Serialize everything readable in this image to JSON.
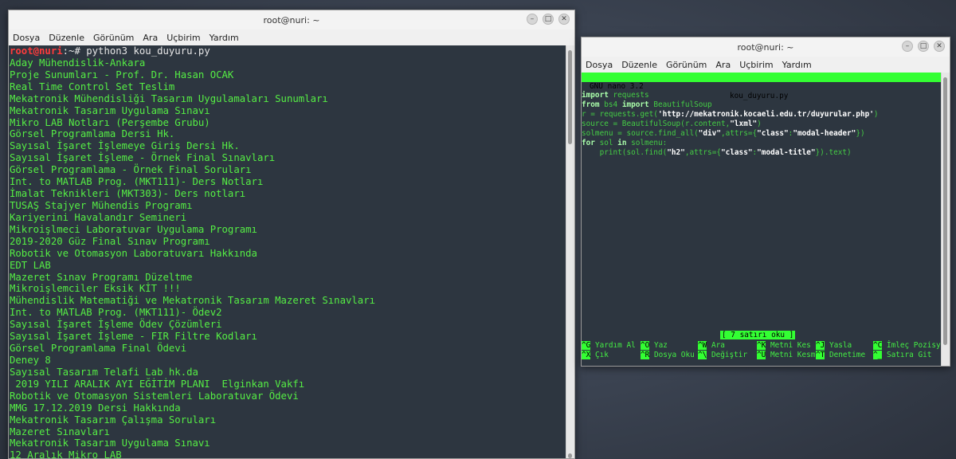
{
  "left_window": {
    "title": "root@nuri: ~",
    "menu": [
      "Dosya",
      "Düzenle",
      "Görünüm",
      "Ara",
      "Uçbirim",
      "Yardım"
    ],
    "prompt_user": "root@nuri",
    "prompt_rest": ":~# python3 kou_duyuru.py",
    "output_lines": [
      "Aday Mühendislik-Ankara",
      "Proje Sunumları - Prof. Dr. Hasan OCAK",
      "Real Time Control Set Teslim",
      "Mekatronik Mühendisliği Tasarım Uygulamaları Sunumları",
      "Mekatronik Tasarım Uygulama Sınavı",
      "Mikro LAB Notları (Perşembe Grubu)",
      "Görsel Programlama Dersi Hk.",
      "Sayısal İşaret İşlemeye Giriş Dersi Hk.",
      "Sayısal İşaret İşleme - Örnek Final Sınavları",
      "Görsel Programlama - Örnek Final Soruları",
      "Int. to MATLAB Prog. (MKT111)- Ders Notları",
      "İmalat Teknikleri (MKT303)- Ders notları",
      "TUSAŞ Stajyer Mühendis Programı",
      "Kariyerini Havalandır Semineri",
      "Mikroişlmeci Laboratuvar Uygulama Programı",
      "2019-2020 Güz Final Sınav Programı",
      "Robotik ve Otomasyon Laboratuvarı Hakkında",
      "EDT LAB",
      "Mazeret Sınav Programı Düzeltme",
      "Mikroişlemciler Eksik KİT !!!",
      "Mühendislik Matematiği ve Mekatronik Tasarım Mazeret Sınavları",
      "Int. to MATLAB Prog. (MKT111)- Ödev2",
      "Sayısal İşaret İşleme Ödev Çözümleri",
      "Sayısal İşaret İşleme - FIR Filtre Kodları",
      "Görsel Programlama Final Ödevi",
      "Deney 8",
      "Sayısal Tasarım Telafi Lab hk.da",
      " 2019 YILI ARALIK AYI EĞİTİM PLANI  Elginkan Vakfı",
      "Robotik ve Otomasyon Sistemleri Laboratuvar Ödevi",
      "MMG 17.12.2019 Dersi Hakkında",
      "Mekatronik Tasarım Çalışma Soruları",
      "Mazeret Sınavları",
      "Mekatronik Tasarım Uygulama Sınavı",
      "12 Aralık Mikro LAB"
    ]
  },
  "right_window": {
    "title": "root@nuri: ~",
    "menu": [
      "Dosya",
      "Düzenle",
      "Görünüm",
      "Ara",
      "Uçbirim",
      "Yardım"
    ],
    "nano_version": "GNU nano 3.2",
    "file_name": "kou_duyuru.py",
    "status_message": "[ 7 satırı oku ]",
    "code_lines": [
      [
        {
          "t": "import",
          "c": "kw"
        },
        {
          "t": " requests",
          "c": ""
        }
      ],
      [
        {
          "t": "from",
          "c": "kw"
        },
        {
          "t": " bs4 ",
          "c": ""
        },
        {
          "t": "import",
          "c": "kw"
        },
        {
          "t": " BeautifulSoup",
          "c": ""
        }
      ],
      [
        {
          "t": "r = requests.get(",
          "c": ""
        },
        {
          "t": "'http://mekatronik.kocaeli.edu.tr/duyurular.php'",
          "c": "str"
        },
        {
          "t": ")",
          "c": ""
        }
      ],
      [
        {
          "t": "source = BeautifulSoup(r.content,",
          "c": ""
        },
        {
          "t": "\"lxml\"",
          "c": "str"
        },
        {
          "t": ")",
          "c": ""
        }
      ],
      [
        {
          "t": "solmenu = source.find_all(",
          "c": ""
        },
        {
          "t": "\"div\"",
          "c": "str"
        },
        {
          "t": ",attrs={",
          "c": ""
        },
        {
          "t": "\"class\"",
          "c": "str"
        },
        {
          "t": ":",
          "c": ""
        },
        {
          "t": "\"modal-header\"",
          "c": "str"
        },
        {
          "t": "})",
          "c": ""
        }
      ],
      [
        {
          "t": "for",
          "c": "kw"
        },
        {
          "t": " sol ",
          "c": ""
        },
        {
          "t": "in",
          "c": "kw"
        },
        {
          "t": " solmenu:",
          "c": ""
        }
      ],
      [
        {
          "t": "    print(sol.find(",
          "c": ""
        },
        {
          "t": "\"h2\"",
          "c": "str"
        },
        {
          "t": ",attrs={",
          "c": ""
        },
        {
          "t": "\"class\"",
          "c": "str"
        },
        {
          "t": ":",
          "c": ""
        },
        {
          "t": "\"modal-title\"",
          "c": "str"
        },
        {
          "t": "}).text)",
          "c": ""
        }
      ]
    ],
    "shortcuts_row1": [
      {
        "key": "^G",
        "label": "Yardım Al"
      },
      {
        "key": "^O",
        "label": "Yaz"
      },
      {
        "key": "^W",
        "label": "Ara"
      },
      {
        "key": "^K",
        "label": "Metni Kes"
      },
      {
        "key": "^J",
        "label": "Yasla"
      },
      {
        "key": "^C",
        "label": "İmleç Pozisy"
      }
    ],
    "shortcuts_row2": [
      {
        "key": "^X",
        "label": "Çık"
      },
      {
        "key": "^R",
        "label": "Dosya Oku"
      },
      {
        "key": "^\\",
        "label": "Değiştir"
      },
      {
        "key": "^U",
        "label": "Metni Kesm"
      },
      {
        "key": "^T",
        "label": "Denetime"
      },
      {
        "key": "^_",
        "label": "Satıra Git"
      }
    ]
  }
}
